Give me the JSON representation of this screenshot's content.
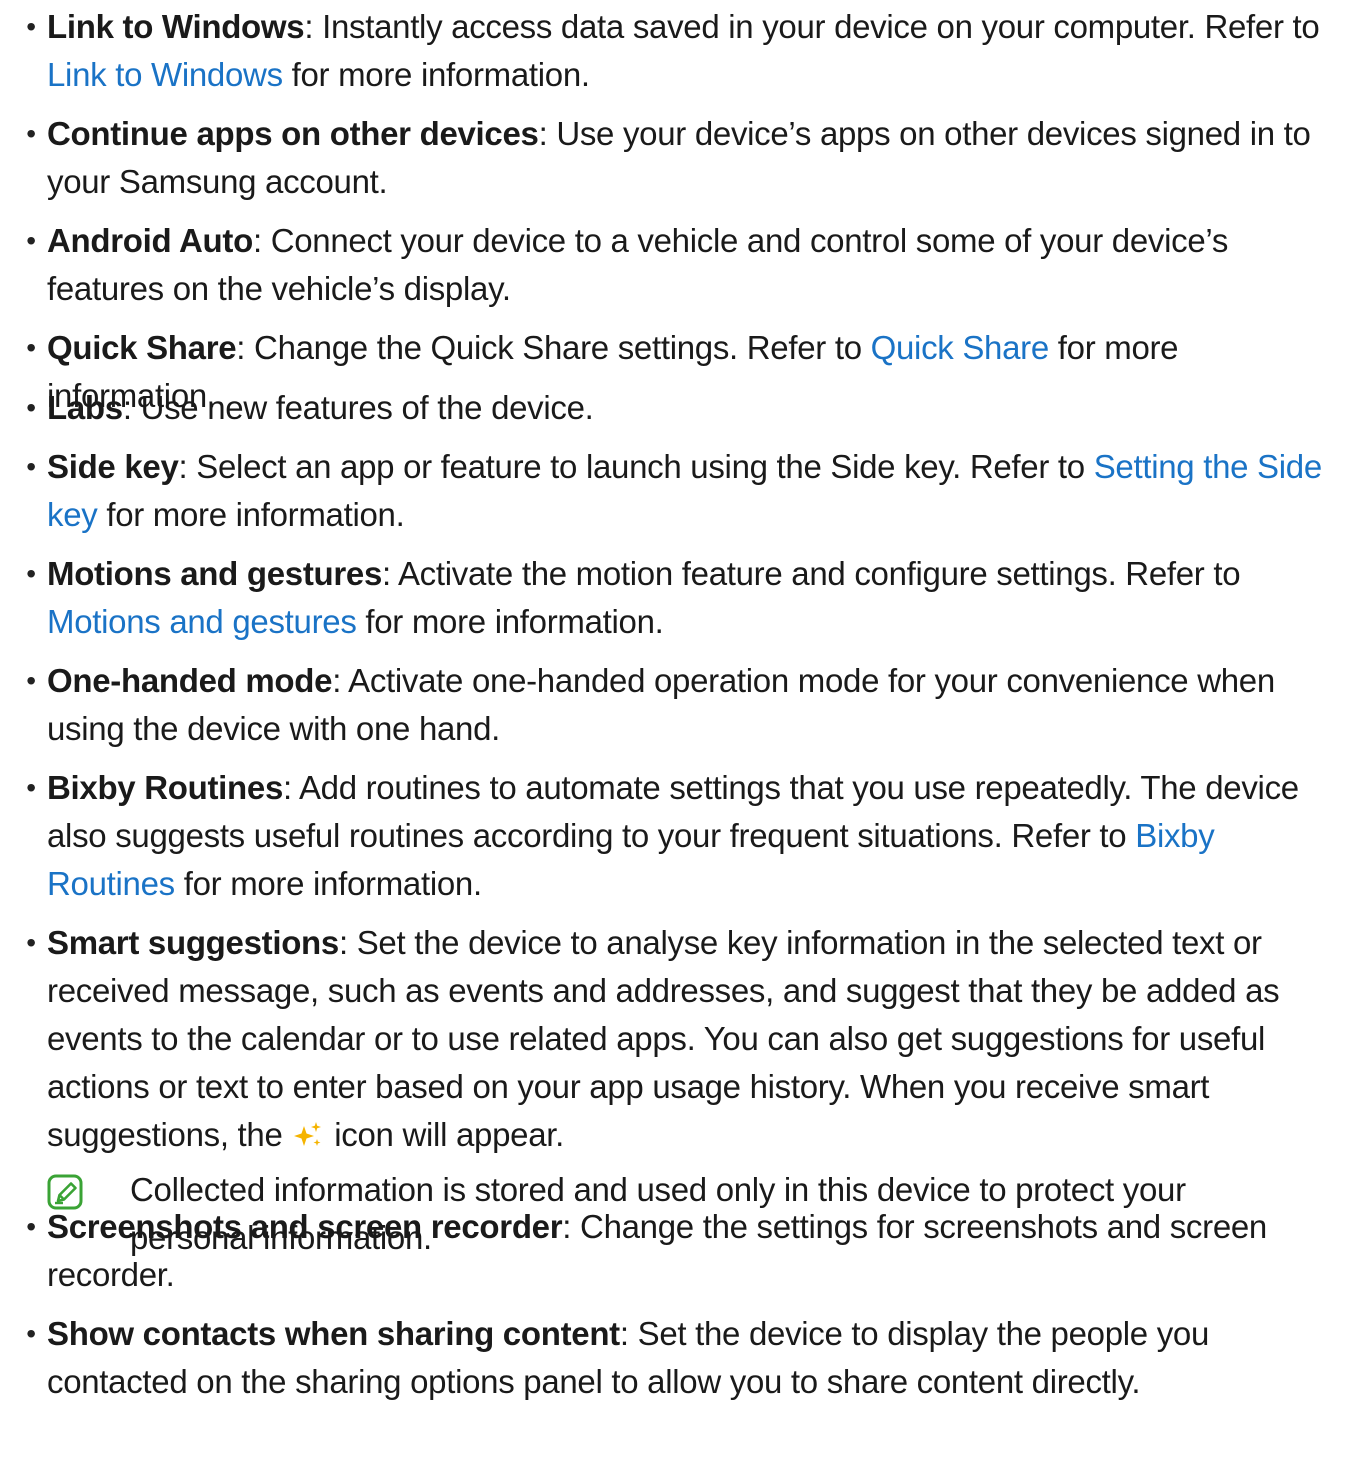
{
  "items": [
    {
      "term": "Link to Windows",
      "sep": ": ",
      "text": "Instantly access data saved in your device on your computer. Refer to ",
      "link": "Link to Windows",
      "tail": " for more information."
    },
    {
      "term": "Continue apps on other devices",
      "sep": ": ",
      "text": "Use your device’s apps on other devices signed in to your Samsung account."
    },
    {
      "term": "Android Auto",
      "sep": ": ",
      "text": "Connect your device to a vehicle and control some of your device’s features on the vehicle’s display."
    },
    {
      "term": "Quick Share",
      "sep": ": ",
      "text": "Change the Quick Share settings. Refer to ",
      "link": "Quick Share",
      "tail": " for more information."
    },
    {
      "term": "Labs",
      "sep": ": ",
      "text": "Use new features of the device."
    },
    {
      "term": "Side key",
      "sep": ": ",
      "text": "Select an app or feature to launch using the Side key. Refer to ",
      "link": "Setting the Side key",
      "tail": " for more information."
    },
    {
      "term": "Motions and gestures",
      "sep": ": ",
      "text": "Activate the motion feature and configure settings. Refer to ",
      "link": "Motions and gestures",
      "tail": " for more information."
    },
    {
      "term": "One-handed mode",
      "sep": ": ",
      "text": "Activate one-handed operation mode for your convenience when using the device with one hand."
    },
    {
      "term": "Bixby Routines",
      "sep": ": ",
      "text": "Add routines to automate settings that you use repeatedly. The device also suggests useful routines according to your frequent situations. Refer to ",
      "link": "Bixby Routines",
      "tail": " for more information."
    },
    {
      "term": "Smart suggestions",
      "sep": ": ",
      "text": "Set the device to analyse key information in the selected text or received message, such as events and addresses, and suggest that they be added as events to the calendar or to use related apps. You can also get suggestions for useful actions or text to enter based on your app usage history. When you receive smart suggestions, the ",
      "icon": "sparkle-icon",
      "tail": " icon will appear."
    },
    {
      "term": "Screenshots and screen recorder",
      "sep": ": ",
      "text": "Change the settings for screenshots and screen recorder."
    },
    {
      "term": "Show contacts when sharing content",
      "sep": ": ",
      "text": "Set the device to display the people you contacted on the sharing options panel to allow you to share content directly."
    }
  ],
  "note": {
    "icon": "note-pencil-icon",
    "text": "Collected information is stored and used only in this device to protect your personal information."
  },
  "colors": {
    "link": "#1a73c6",
    "note_icon": "#3aa335",
    "sparkle": "#f5b400"
  }
}
